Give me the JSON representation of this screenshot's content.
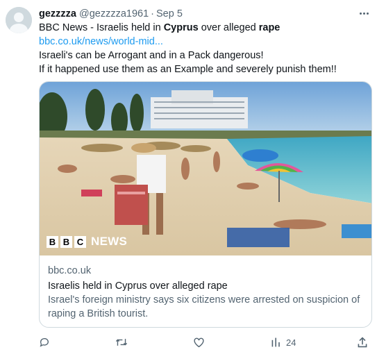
{
  "tweet": {
    "display_name": "gezzzza",
    "handle": "@gezzzza1961",
    "separator": "·",
    "date": "Sep 5",
    "text": {
      "line1_prefix": "BBC News - Israelis held in ",
      "line1_bold1": "Cyprus",
      "line1_middle": " over alleged ",
      "line1_bold2": "rape",
      "link": "bbc.co.uk/news/world-mid...",
      "line3": "Israeli's can be Arrogant and in a Pack dangerous!",
      "line4": "If it happened use them as an Example and severely punish them!!"
    }
  },
  "card": {
    "image_logo": {
      "b1": "B",
      "b2": "B",
      "c": "C",
      "news": "NEWS"
    },
    "domain": "bbc.co.uk",
    "title": "Israelis held in Cyprus over alleged rape",
    "description_line1": "Israel's foreign ministry says six citizens were arrested on suspicion of",
    "description_line2": "raping a British tourist."
  },
  "actions": {
    "reply_icon": "reply-icon",
    "retweet_icon": "retweet-icon",
    "like_icon": "heart-icon",
    "views_icon": "views-chart-icon",
    "views_count": "24",
    "share_icon": "share-icon"
  },
  "colors": {
    "text": "#0f1419",
    "secondary": "#536471",
    "link": "#1d9bf0",
    "border": "#cfd9de"
  }
}
